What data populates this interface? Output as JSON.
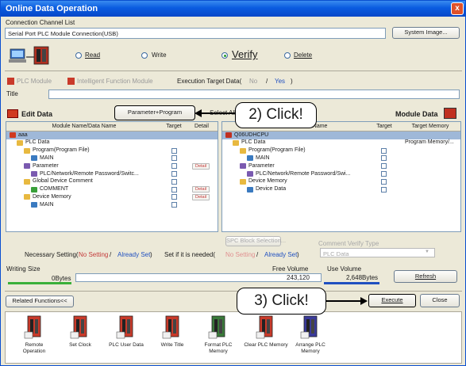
{
  "window": {
    "title": "Online Data Operation",
    "close": "x"
  },
  "connection": {
    "section_label": "Connection Channel List",
    "value": "Serial Port  PLC Module Connection(USB)",
    "system_image": "System Image..."
  },
  "modes": {
    "read": "Read",
    "write": "Write",
    "verify": "Verify",
    "delete": "Delete",
    "selected": "verify"
  },
  "target_bar": {
    "plc_module": "PLC Module",
    "intelligent": "Intelligent Function Module",
    "execution_target": "Execution Target Data(",
    "no": "No",
    "slash": "/",
    "yes": "Yes",
    "close_paren": ")"
  },
  "title_label": "Title",
  "edit_data": {
    "heading": "Edit Data",
    "param_button": "Parameter+Program",
    "select_all": "Select All",
    "columns": [
      "Module Name/Data Name",
      "Target",
      "Detail"
    ],
    "rows": [
      {
        "name": "aaa",
        "indent": 0,
        "highlight": true,
        "check": false,
        "detail": "",
        "icon": "project"
      },
      {
        "name": "PLC Data",
        "indent": 1,
        "highlight": false,
        "check": false,
        "detail": "",
        "icon": "folder"
      },
      {
        "name": "Program(Program File)",
        "indent": 2,
        "highlight": false,
        "check": true,
        "detail": "",
        "icon": "folder"
      },
      {
        "name": "MAIN",
        "indent": 3,
        "highlight": false,
        "check": true,
        "detail": "",
        "icon": "program"
      },
      {
        "name": "Parameter",
        "indent": 2,
        "highlight": false,
        "check": true,
        "detail": "Detail",
        "icon": "param"
      },
      {
        "name": "PLC/Network/Remote Password/Switc...",
        "indent": 3,
        "highlight": false,
        "check": true,
        "detail": "",
        "icon": "param"
      },
      {
        "name": "Global Device Comment",
        "indent": 2,
        "highlight": false,
        "check": true,
        "detail": "",
        "icon": "folder"
      },
      {
        "name": "COMMENT",
        "indent": 3,
        "highlight": false,
        "check": true,
        "detail": "Detail",
        "icon": "comment"
      },
      {
        "name": "Device Memory",
        "indent": 2,
        "highlight": false,
        "check": true,
        "detail": "Detail",
        "icon": "folder"
      },
      {
        "name": "MAIN",
        "indent": 3,
        "highlight": false,
        "check": true,
        "detail": "",
        "icon": "program"
      }
    ]
  },
  "module_data": {
    "heading": "Module Data",
    "columns": [
      "Module Name/Data Name",
      "Target",
      "Target Memory"
    ],
    "rows": [
      {
        "name": "Q06UDHCPU",
        "indent": 0,
        "highlight": true,
        "check": false,
        "memory": "",
        "icon": "cpu"
      },
      {
        "name": "PLC Data",
        "indent": 1,
        "highlight": false,
        "check": false,
        "memory": "Program Memory/...",
        "icon": "folder"
      },
      {
        "name": "Program(Program File)",
        "indent": 2,
        "highlight": false,
        "check": true,
        "memory": "",
        "icon": "folder"
      },
      {
        "name": "MAIN",
        "indent": 3,
        "highlight": false,
        "check": true,
        "memory": "",
        "icon": "program"
      },
      {
        "name": "Parameter",
        "indent": 2,
        "highlight": false,
        "check": true,
        "memory": "",
        "icon": "param"
      },
      {
        "name": "PLC/Network/Remote Password/Swi...",
        "indent": 3,
        "highlight": false,
        "check": true,
        "memory": "",
        "icon": "param"
      },
      {
        "name": "Device Memory",
        "indent": 2,
        "highlight": false,
        "check": true,
        "memory": "",
        "icon": "folder"
      },
      {
        "name": "Device Data",
        "indent": 3,
        "highlight": false,
        "check": true,
        "memory": "",
        "icon": "program"
      }
    ]
  },
  "spc_block": "SPC Block Selection...",
  "comment_verify_type": "Comment Verify Type",
  "comment_verify_value": "PLC Data",
  "necessary": {
    "label": "Necessary Setting(",
    "no_setting": "No Setting",
    "slash": "/",
    "already_set": "Already Set",
    "close": ")"
  },
  "set_if_needed": {
    "label": "Set if it is needed(",
    "no_setting": "No Setting",
    "slash": "/",
    "already_set": "Already Set",
    "close": ")"
  },
  "sizes": {
    "writing_size_label": "Writing Size",
    "writing_size_value": "0Bytes",
    "free_volume_label": "Free Volume",
    "free_volume_value": "243,120",
    "use_volume_label": "Use Volume",
    "use_volume_value": "2,648Bytes",
    "refresh": "Refresh"
  },
  "footer": {
    "related_functions": "Related Functions<<",
    "execute": "Execute",
    "close": "Close"
  },
  "related_functions": [
    {
      "label": "Remote\nOperation",
      "icon": "remote-operation-icon",
      "color": "#c93a2a"
    },
    {
      "label": "Set Clock",
      "icon": "set-clock-icon",
      "color": "#c93a2a"
    },
    {
      "label": "PLC User Data",
      "icon": "plc-user-data-icon",
      "color": "#c93a2a"
    },
    {
      "label": "Write Title",
      "icon": "write-title-icon",
      "color": "#c93a2a"
    },
    {
      "label": "Format PLC\nMemory",
      "icon": "format-plc-memory-icon",
      "color": "#3a7a3a"
    },
    {
      "label": "Clear PLC Memory",
      "icon": "clear-plc-memory-icon",
      "color": "#c93a2a"
    },
    {
      "label": "Arrange PLC\nMemory",
      "icon": "arrange-plc-memory-icon",
      "color": "#3a3a9a"
    }
  ],
  "callouts": {
    "step2": "2) Click!",
    "step3": "3) Click!"
  },
  "colors": {
    "accent_red": "#d03a20",
    "highlight_row": "#9fb8d8",
    "title_blue": "#0a5ce0",
    "link_blue": "#2050c0",
    "no_setting_red": "#c43a3a"
  }
}
